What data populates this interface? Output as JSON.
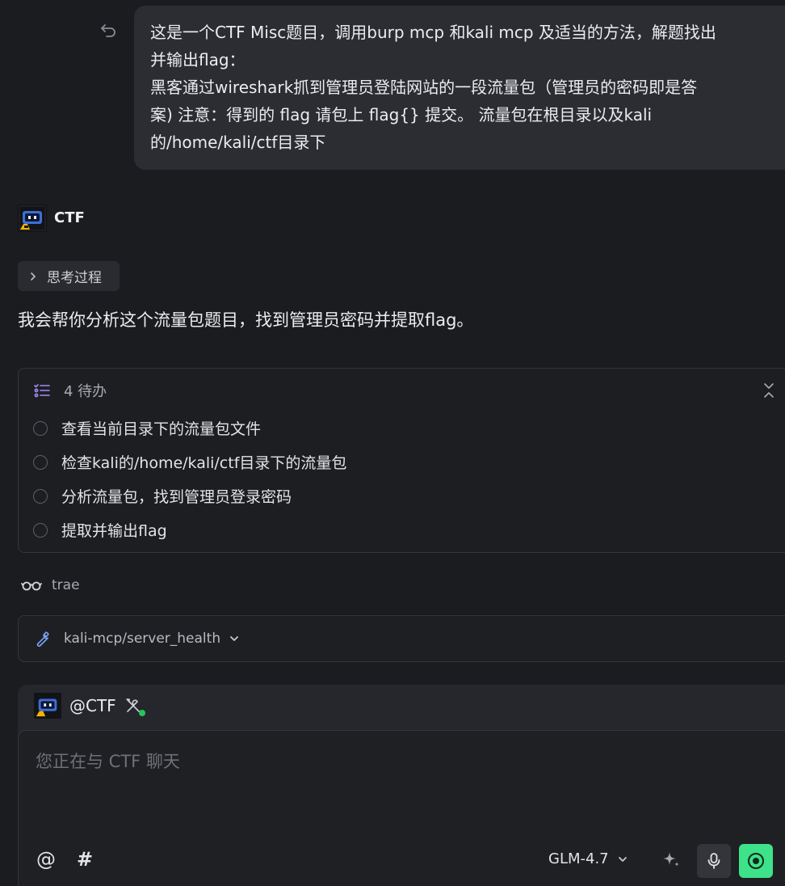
{
  "user_message": {
    "lines": [
      "这是一个CTF Misc题目，调用burp mcp 和kali mcp 及适当的方法，解题找出",
      "并输出flag：",
      "黑客通过wireshark抓到管理员登陆网站的一段流量包（管理员的密码即是答",
      "案) 注意：得到的 flag 请包上 flag{} 提交。 流量包在根目录以及kali",
      "的/home/kali/ctf目录下"
    ]
  },
  "agent": {
    "name": "CTF",
    "thinking_label": "思考过程",
    "reply": "我会帮你分析这个流量包题目，找到管理员密码并提取flag。"
  },
  "todo": {
    "header": "4 待办",
    "items": [
      "查看当前目录下的流量包文件",
      "检查kali的/home/kali/ctf目录下的流量包",
      "分析流量包，找到管理员登录密码",
      "提取并输出flag"
    ]
  },
  "trae": {
    "label": "trae"
  },
  "tool_call": {
    "name": "kali-mcp/server_health"
  },
  "composer": {
    "mention": "@CTF",
    "placeholder": "您正在与 CTF 聊天",
    "at_symbol": "@",
    "hash_symbol": "#",
    "model": "GLM-4.7"
  },
  "colors": {
    "background": "#1b1c20",
    "bubble": "#2c2d33",
    "send_button": "#3ee28a",
    "todo_icon": "#a78bfa",
    "wrench_icon": "#7aa2f7",
    "online_dot": "#22c55e"
  },
  "icons": {
    "undo": "undo-icon",
    "avatar": "robot-avatar-icon",
    "thinking": "chevron-right-icon",
    "todo": "checklist-icon",
    "collapse": "collapse-icon",
    "trae": "glasses-icon",
    "tool": "wrench-icon",
    "tools": "tools-icon",
    "sparkle": "sparkle-icon",
    "mic": "microphone-icon",
    "send": "send-icon"
  }
}
